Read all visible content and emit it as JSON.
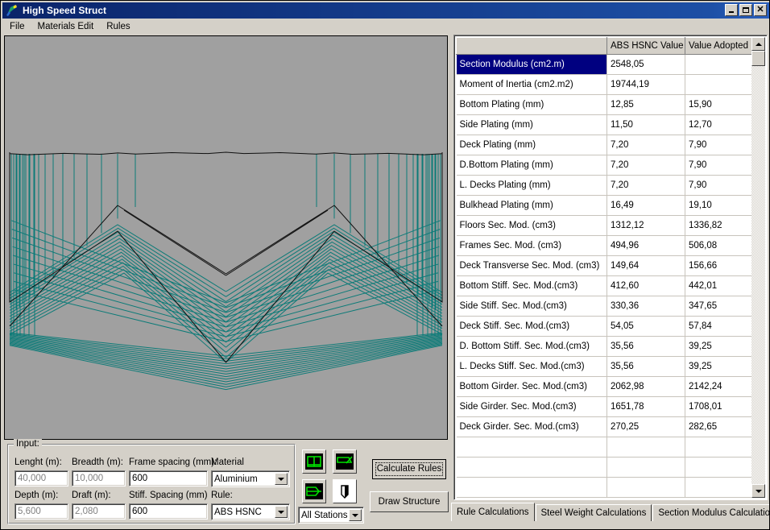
{
  "window": {
    "title": "High Speed Struct",
    "icon": "app-icon",
    "controls": {
      "minimize": "minimize-button",
      "maximize": "maximize-button",
      "close": "close-button"
    }
  },
  "menu": {
    "items": [
      {
        "label": "File"
      },
      {
        "label": "Materials Edit"
      },
      {
        "label": "Rules"
      }
    ]
  },
  "canvas": {
    "name": "structure-drawing",
    "background": "#a0a0a0",
    "hull_color": "#008080",
    "outline_color": "#000000"
  },
  "input_panel": {
    "legend": "Input:",
    "fields": [
      {
        "name": "length",
        "label": "Lenght (m):",
        "value": "40,000",
        "disabled": true
      },
      {
        "name": "breadth",
        "label": "Breadth (m):",
        "value": "10,000",
        "disabled": true
      },
      {
        "name": "frame-spacing",
        "label": "Frame spacing (mm):",
        "value": "600",
        "disabled": false
      },
      {
        "name": "material",
        "label": "Material",
        "value": "Aluminium",
        "type": "combo"
      },
      {
        "name": "depth",
        "label": "Depth (m):",
        "value": "5,600",
        "disabled": true
      },
      {
        "name": "draft",
        "label": "Draft (m):",
        "value": "2,080",
        "disabled": true
      },
      {
        "name": "stiff-spacing",
        "label": "Stiff. Spacing (mm)",
        "value": "600",
        "disabled": false
      },
      {
        "name": "rule",
        "label": "Rule:",
        "value": "ABS HSNC",
        "type": "combo"
      }
    ]
  },
  "toolbar": {
    "icons": [
      {
        "name": "midship-section-icon",
        "label": "Midship Section"
      },
      {
        "name": "profile-view-icon",
        "label": "Profile View"
      },
      {
        "name": "plan-view-icon",
        "label": "Plan View"
      },
      {
        "name": "bulkhead-icon",
        "label": "Bulkhead"
      }
    ],
    "stations_combo": {
      "name": "stations-select",
      "value": "All Stations"
    },
    "calculate_rules_label": "Calculate Rules",
    "draw_structure_label": "Draw Structure"
  },
  "grid": {
    "columns": [
      "",
      "ABS HSNC Value",
      "Value Adopted"
    ],
    "selected_row": 0,
    "rows": [
      {
        "item": "Section Modulus (cm2.m)",
        "abs": "2548,05",
        "adopted": ""
      },
      {
        "item": "Moment of Inertia (cm2.m2)",
        "abs": "19744,19",
        "adopted": ""
      },
      {
        "item": "Bottom Plating (mm)",
        "abs": "12,85",
        "adopted": "15,90"
      },
      {
        "item": "Side Plating (mm)",
        "abs": "11,50",
        "adopted": "12,70"
      },
      {
        "item": "Deck Plating (mm)",
        "abs": "7,20",
        "adopted": "7,90"
      },
      {
        "item": "D.Bottom Plating (mm)",
        "abs": "7,20",
        "adopted": "7,90"
      },
      {
        "item": "L. Decks Plating (mm)",
        "abs": "7,20",
        "adopted": "7,90"
      },
      {
        "item": "Bulkhead Plating (mm)",
        "abs": "16,49",
        "adopted": "19,10"
      },
      {
        "item": "Floors Sec. Mod. (cm3)",
        "abs": "1312,12",
        "adopted": "1336,82"
      },
      {
        "item": "Frames Sec. Mod. (cm3)",
        "abs": "494,96",
        "adopted": "506,08"
      },
      {
        "item": "Deck Transverse Sec. Mod. (cm3)",
        "abs": "149,64",
        "adopted": "156,66"
      },
      {
        "item": "Bottom Stiff. Sec. Mod.(cm3)",
        "abs": "412,60",
        "adopted": "442,01"
      },
      {
        "item": "Side Stiff. Sec. Mod.(cm3)",
        "abs": "330,36",
        "adopted": "347,65"
      },
      {
        "item": "Deck Stiff. Sec. Mod.(cm3)",
        "abs": "54,05",
        "adopted": "57,84"
      },
      {
        "item": "D. Bottom Stiff. Sec. Mod.(cm3)",
        "abs": "35,56",
        "adopted": "39,25"
      },
      {
        "item": "L. Decks Stiff. Sec. Mod.(cm3)",
        "abs": "35,56",
        "adopted": "39,25"
      },
      {
        "item": "Bottom Girder. Sec. Mod.(cm3)",
        "abs": "2062,98",
        "adopted": "2142,24"
      },
      {
        "item": "Side Girder. Sec. Mod.(cm3)",
        "abs": "1651,78",
        "adopted": "1708,01"
      },
      {
        "item": "Deck Girder. Sec. Mod.(cm3)",
        "abs": "270,25",
        "adopted": "282,65"
      },
      {
        "item": "",
        "abs": "",
        "adopted": ""
      },
      {
        "item": "",
        "abs": "",
        "adopted": ""
      },
      {
        "item": "",
        "abs": "",
        "adopted": ""
      }
    ]
  },
  "tabs": [
    {
      "label": "Rule Calculations",
      "active": true
    },
    {
      "label": "Steel Weight Calculations",
      "active": false
    },
    {
      "label": "Section Modulus Calculations",
      "active": false
    }
  ],
  "colors": {
    "titlebar_start": "#0a246a",
    "titlebar_end": "#2a5fbd",
    "face": "#d4d0c8",
    "selection": "#000080",
    "hull_teal": "#008080",
    "icon_green": "#00c000"
  }
}
